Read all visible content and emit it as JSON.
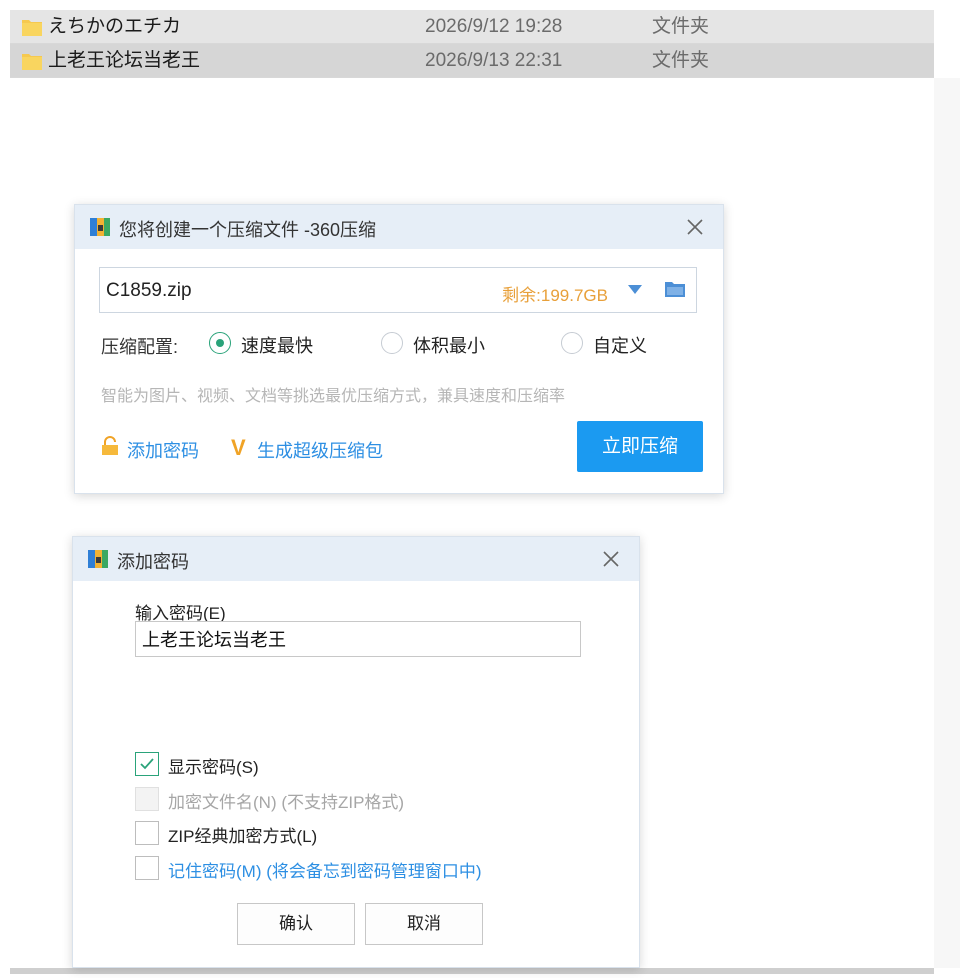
{
  "explorer": {
    "rows": [
      {
        "name": "えちかのエチカ",
        "date": "2026/9/12 19:28",
        "type": "文件夹"
      },
      {
        "name": "上老王论坛当老王",
        "date": "2026/9/13 22:31",
        "type": "文件夹"
      }
    ]
  },
  "compress_dialog": {
    "title": "您将创建一个压缩文件 -360压缩",
    "archive_name": "C1859.zip",
    "remaining_space": "剩余:199.7GB",
    "config_label": "压缩配置:",
    "options": [
      "速度最快",
      "体积最小",
      "自定义"
    ],
    "selected_option": "速度最快",
    "hint": "智能为图片、视频、文档等挑选最优压缩方式，兼具速度和压缩率",
    "add_password_link": "添加密码",
    "super_archive_link": "生成超级压缩包",
    "compress_button": "立即压缩"
  },
  "password_dialog": {
    "title": "添加密码",
    "input_label": "输入密码(E)",
    "password_value": "上老王论坛当老王",
    "checkboxes": [
      {
        "label": "显示密码(S)",
        "checked": true,
        "disabled": false
      },
      {
        "label": "加密文件名(N) (不支持ZIP格式)",
        "checked": false,
        "disabled": true
      },
      {
        "label": "ZIP经典加密方式(L)",
        "checked": false,
        "disabled": false
      },
      {
        "label": "记住密码(M) (将会备忘到密码管理窗口中)",
        "checked": false,
        "disabled": false
      }
    ],
    "ok_button": "确认",
    "cancel_button": "取消"
  },
  "colors": {
    "accent_blue": "#1b9af1",
    "link_blue": "#2d8fe3",
    "remaining_orange": "#e8a03a",
    "check_green": "#2aa37a",
    "folder_yellow": "#f6c94f"
  }
}
